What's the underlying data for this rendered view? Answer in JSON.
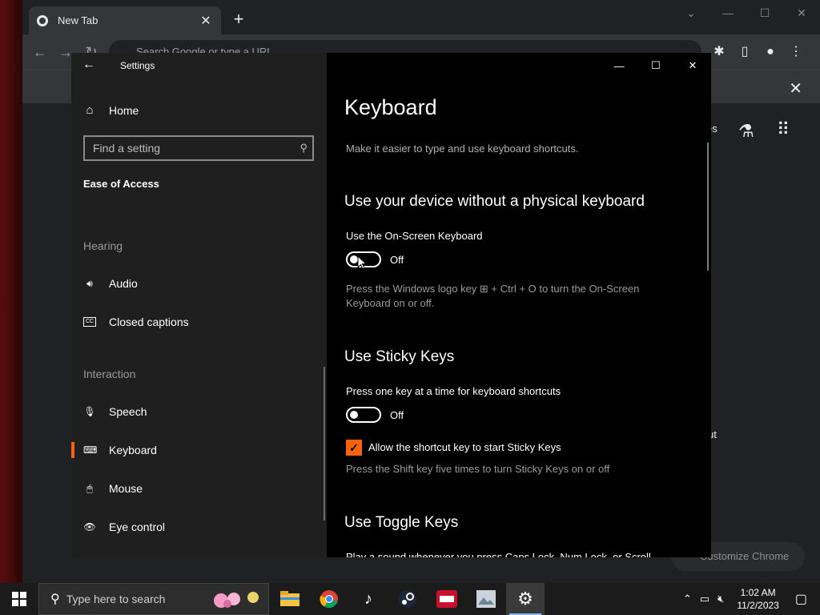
{
  "chrome": {
    "tab_title": "New Tab",
    "tab_close": "✕",
    "new_tab": "+",
    "omnibox_placeholder": "Search Google or type a URL",
    "ntp_fragment_right": "es",
    "ntp_fragment_shortcut": "ut",
    "customize_label": "Customize Chrome"
  },
  "settings": {
    "app_title": "Settings",
    "home_label": "Home",
    "search_placeholder": "Find a setting",
    "section_title": "Ease of Access",
    "groups": {
      "hearing": "Hearing",
      "interaction": "Interaction"
    },
    "nav": {
      "audio": "Audio",
      "closed_captions": "Closed captions",
      "speech": "Speech",
      "keyboard": "Keyboard",
      "mouse": "Mouse",
      "eye_control": "Eye control"
    },
    "active_item": "Keyboard",
    "page": {
      "title": "Keyboard",
      "subtitle": "Make it easier to type and use keyboard shortcuts.",
      "osk": {
        "heading": "Use your device without a physical keyboard",
        "label": "Use the On-Screen Keyboard",
        "state": "Off",
        "desc": "Press the Windows logo key ⊞ + Ctrl + O to turn the On-Screen Keyboard on or off."
      },
      "sticky": {
        "heading": "Use Sticky Keys",
        "label": "Press one key at a time for keyboard shortcuts",
        "state": "Off",
        "checkbox_label": "Allow the shortcut key to start Sticky Keys",
        "checkbox_checked": true,
        "desc": "Press the Shift key five times to turn Sticky Keys on or off"
      },
      "toggle": {
        "heading": "Use Toggle Keys",
        "desc_partial": "Play a sound whenever you press Caps Lock, Num Lock, or Scroll"
      }
    },
    "accent_color": "#f7630c"
  },
  "taskbar": {
    "search_placeholder": "Type here to search",
    "time": "1:02 AM",
    "date": "11/2/2023",
    "apps": [
      "file-explorer",
      "chrome",
      "tiktok",
      "steam",
      "app-red",
      "photos",
      "settings"
    ]
  }
}
